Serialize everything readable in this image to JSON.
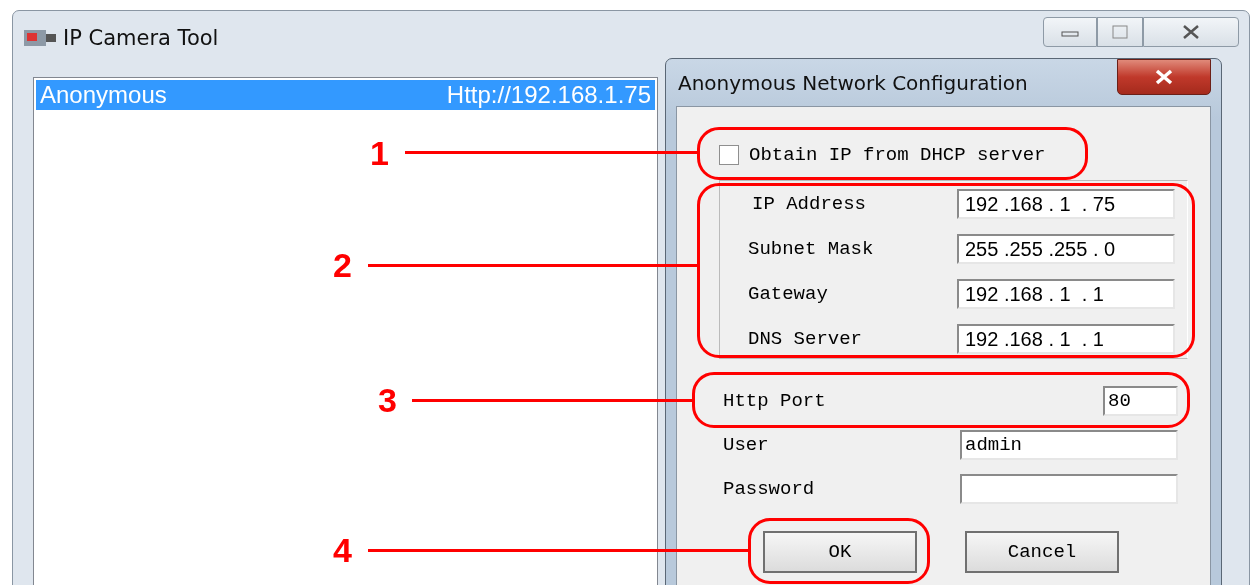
{
  "main_window": {
    "title": "IP Camera Tool",
    "devices": [
      {
        "name": "Anonymous",
        "address": "Http://192.168.1.75",
        "selected": true
      }
    ]
  },
  "dialog": {
    "title": "Anonymous Network Configuration",
    "dhcp": {
      "label": "Obtain IP from DHCP server",
      "checked": false
    },
    "ip_fields": [
      {
        "label": "IP Address",
        "value": "192 .168 . 1  . 75"
      },
      {
        "label": "Subnet Mask",
        "value": "255 .255 .255 . 0"
      },
      {
        "label": "Gateway",
        "value": "192 .168 . 1  . 1"
      },
      {
        "label": "DNS Server",
        "value": "192 .168 . 1  . 1"
      }
    ],
    "http_port": {
      "label": "Http Port",
      "value": "80"
    },
    "user": {
      "label": "User",
      "value": "admin"
    },
    "password": {
      "label": "Password"
    },
    "buttons": [
      "OK",
      "Cancel"
    ]
  },
  "callouts": [
    {
      "label": "1"
    },
    {
      "label": "2"
    },
    {
      "label": "3"
    },
    {
      "label": "4"
    }
  ]
}
